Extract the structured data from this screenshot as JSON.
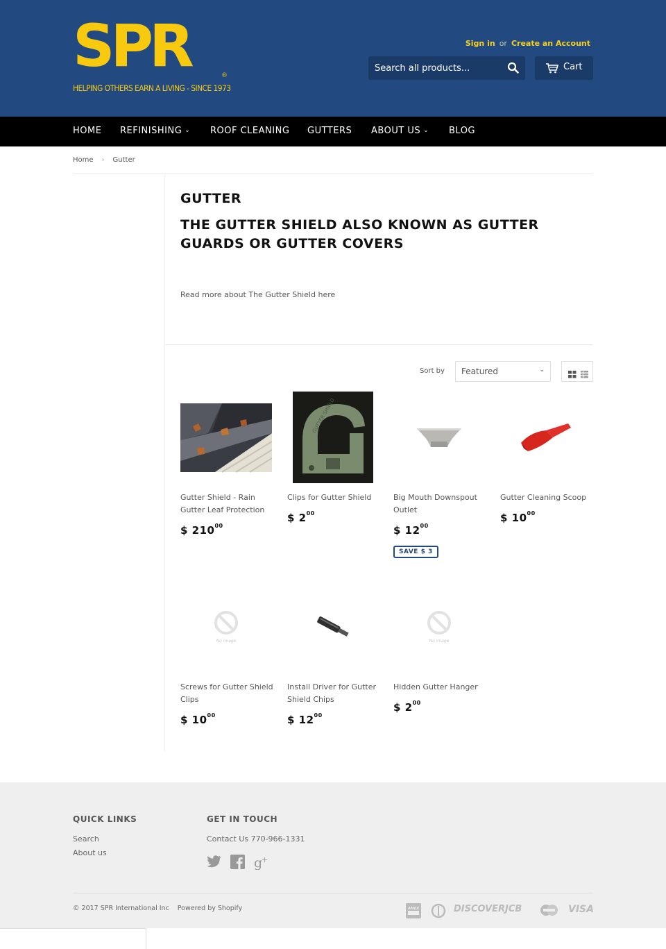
{
  "header": {
    "logo_text": "SPR",
    "logo_registered": "®",
    "logo_tagline": "HELPING OTHERS EARN A LIVING - SINCE 1973",
    "sign_in": "Sign in",
    "or": "or",
    "create_account": "Create an Account",
    "search_placeholder": "Search all products...",
    "cart_label": "Cart",
    "background_color": "#234a80",
    "accent_color": "#f7c90f"
  },
  "nav": {
    "items": [
      {
        "label": "HOME",
        "has_dropdown": false
      },
      {
        "label": "REFINISHING",
        "has_dropdown": true
      },
      {
        "label": "ROOF CLEANING",
        "has_dropdown": false
      },
      {
        "label": "GUTTERS",
        "has_dropdown": false
      },
      {
        "label": "ABOUT US",
        "has_dropdown": true
      },
      {
        "label": "BLOG",
        "has_dropdown": false
      }
    ],
    "chevron": "⌄"
  },
  "breadcrumb": {
    "home": "Home",
    "separator": "›",
    "current": "Gutter"
  },
  "collection": {
    "title": "GUTTER",
    "subtitle": "THE GUTTER SHIELD ALSO KNOWN AS GUTTER GUARDS OR GUTTER COVERS",
    "read_more": "Read more about The Gutter Shield here"
  },
  "sort": {
    "label": "Sort by",
    "selected": "Featured"
  },
  "products": [
    {
      "name": "Gutter Shield - Rain Gutter Leaf Protection",
      "price_whole": "$ 210",
      "price_cents": "00",
      "image": "gutter-shield-photo"
    },
    {
      "name": "Clips for Gutter Shield",
      "price_whole": "$ 2",
      "price_cents": "00",
      "image": "clip-photo"
    },
    {
      "name": "Big Mouth Downspout Outlet",
      "price_whole": "$ 12",
      "price_cents": "00",
      "image": "downspout-photo",
      "badge": "SAVE $ 3"
    },
    {
      "name": "Gutter Cleaning Scoop",
      "price_whole": "$ 10",
      "price_cents": "00",
      "image": "scoop-photo"
    },
    {
      "name": "Screws for Gutter Shield Clips",
      "price_whole": "$ 10",
      "price_cents": "00",
      "image": "no-image",
      "no_image_text": "No image"
    },
    {
      "name": "Install Driver for Gutter Shield Chips",
      "price_whole": "$ 12",
      "price_cents": "00",
      "image": "driver-photo"
    },
    {
      "name": "Hidden Gutter Hanger",
      "price_whole": "$ 2",
      "price_cents": "00",
      "image": "no-image",
      "no_image_text": "No image"
    }
  ],
  "footer": {
    "quick_links_heading": "QUICK LINKS",
    "quick_links": [
      "Search",
      "About us"
    ],
    "contact_heading": "GET IN TOUCH",
    "contact_text": "Contact Us 770-966-1331",
    "social": [
      "twitter-icon",
      "facebook-icon",
      "google-plus-icon"
    ],
    "copyright": "© 2017 SPR International Inc",
    "powered": "Powered by Shopify",
    "payment_methods": [
      "AMEX",
      "DINERS",
      "DISCOVER",
      "JCB",
      "MASTER",
      "VISA"
    ]
  }
}
